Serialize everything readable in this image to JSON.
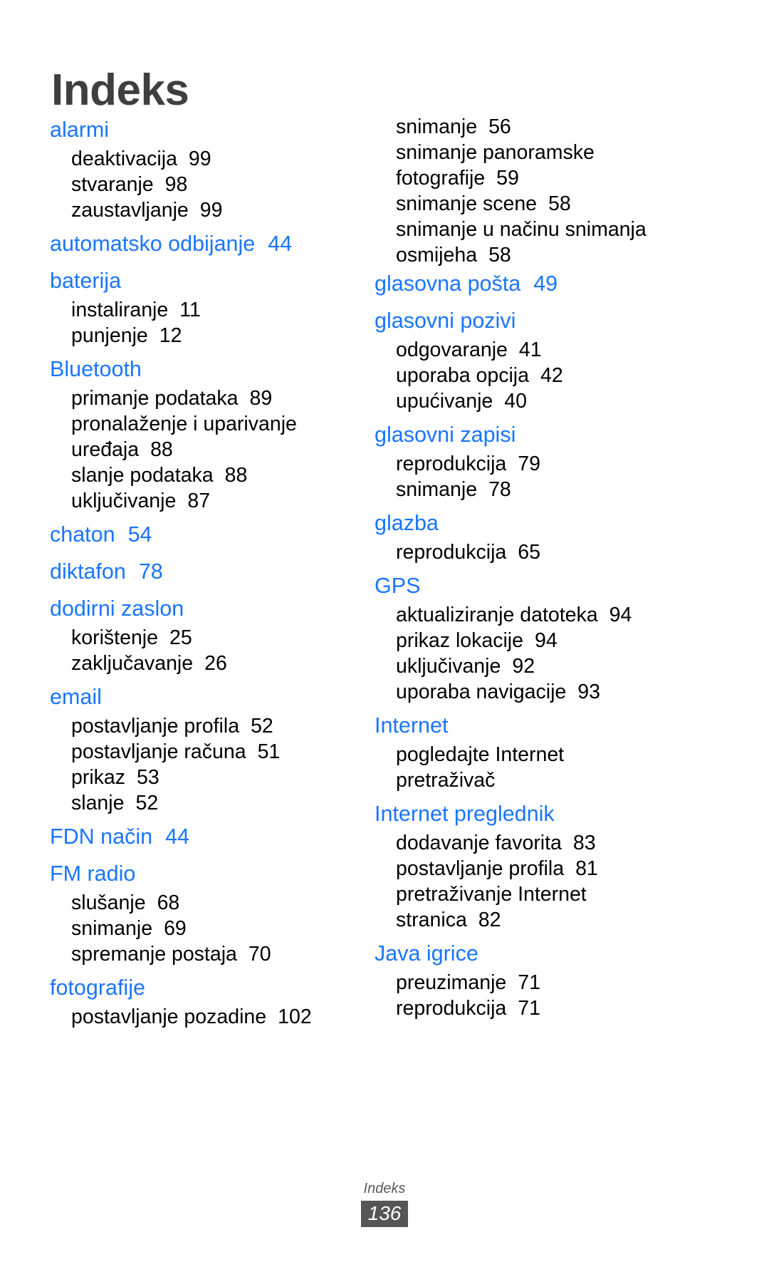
{
  "page_title": "Indeks",
  "footer": {
    "label": "Indeks",
    "page_number": "136"
  },
  "colors": {
    "heading": "#1a75ff",
    "title": "#3f3f3f",
    "body": "#000000",
    "badge_bg": "#565656",
    "badge_text": "#ffffff"
  },
  "columns": [
    {
      "name": "left",
      "entries": [
        {
          "type": "heading",
          "term": "alarmi",
          "page": ""
        },
        {
          "type": "sub",
          "term": "deaktivacija",
          "page": "99"
        },
        {
          "type": "sub",
          "term": "stvaranje",
          "page": "98"
        },
        {
          "type": "sub",
          "term": "zaustavljanje",
          "page": "99"
        },
        {
          "type": "heading",
          "term": "automatsko odbijanje",
          "page": "44"
        },
        {
          "type": "heading",
          "term": "baterija",
          "page": ""
        },
        {
          "type": "sub",
          "term": "instaliranje",
          "page": "11"
        },
        {
          "type": "sub",
          "term": "punjenje",
          "page": "12"
        },
        {
          "type": "heading",
          "term": "Bluetooth",
          "page": ""
        },
        {
          "type": "sub",
          "term": "primanje podataka",
          "page": "89"
        },
        {
          "type": "sub",
          "term": "pronalaženje i uparivanje",
          "page": ""
        },
        {
          "type": "sub",
          "term": "uređaja",
          "page": "88"
        },
        {
          "type": "sub",
          "term": "slanje podataka",
          "page": "88"
        },
        {
          "type": "sub",
          "term": "uključivanje",
          "page": "87"
        },
        {
          "type": "heading",
          "term": "chaton",
          "page": "54"
        },
        {
          "type": "heading",
          "term": "diktafon",
          "page": "78"
        },
        {
          "type": "heading",
          "term": "dodirni zaslon",
          "page": ""
        },
        {
          "type": "sub",
          "term": "korištenje",
          "page": "25"
        },
        {
          "type": "sub",
          "term": "zaključavanje",
          "page": "26"
        },
        {
          "type": "heading",
          "term": "email",
          "page": ""
        },
        {
          "type": "sub",
          "term": "postavljanje profila",
          "page": "52"
        },
        {
          "type": "sub",
          "term": "postavljanje računa",
          "page": "51"
        },
        {
          "type": "sub",
          "term": "prikaz",
          "page": "53"
        },
        {
          "type": "sub",
          "term": "slanje",
          "page": "52"
        },
        {
          "type": "heading",
          "term": "FDN način",
          "page": "44"
        },
        {
          "type": "heading",
          "term": "FM radio",
          "page": ""
        },
        {
          "type": "sub",
          "term": "slušanje",
          "page": "68"
        },
        {
          "type": "sub",
          "term": "snimanje",
          "page": "69"
        },
        {
          "type": "sub",
          "term": "spremanje postaja",
          "page": "70"
        },
        {
          "type": "heading",
          "term": "fotografije",
          "page": ""
        },
        {
          "type": "sub",
          "term": "postavljanje pozadine",
          "page": "102"
        }
      ]
    },
    {
      "name": "right",
      "entries": [
        {
          "type": "sub",
          "term": "snimanje",
          "page": "56"
        },
        {
          "type": "sub",
          "term": "snimanje panoramske",
          "page": ""
        },
        {
          "type": "sub",
          "term": "fotografije",
          "page": "59"
        },
        {
          "type": "sub",
          "term": "snimanje scene",
          "page": "58"
        },
        {
          "type": "sub",
          "term": "snimanje u načinu snimanja",
          "page": ""
        },
        {
          "type": "sub",
          "term": "osmijeha",
          "page": "58"
        },
        {
          "type": "heading",
          "term": "glasovna pošta",
          "page": "49"
        },
        {
          "type": "heading",
          "term": "glasovni pozivi",
          "page": ""
        },
        {
          "type": "sub",
          "term": "odgovaranje",
          "page": "41"
        },
        {
          "type": "sub",
          "term": "uporaba opcija",
          "page": "42"
        },
        {
          "type": "sub",
          "term": "upućivanje",
          "page": "40"
        },
        {
          "type": "heading",
          "term": "glasovni zapisi",
          "page": ""
        },
        {
          "type": "sub",
          "term": "reprodukcija",
          "page": "79"
        },
        {
          "type": "sub",
          "term": "snimanje",
          "page": "78"
        },
        {
          "type": "heading",
          "term": "glazba",
          "page": ""
        },
        {
          "type": "sub",
          "term": "reprodukcija",
          "page": "65"
        },
        {
          "type": "heading",
          "term": "GPS",
          "page": ""
        },
        {
          "type": "sub",
          "term": "aktualiziranje datoteka",
          "page": "94"
        },
        {
          "type": "sub",
          "term": "prikaz lokacije",
          "page": "94"
        },
        {
          "type": "sub",
          "term": "uključivanje",
          "page": "92"
        },
        {
          "type": "sub",
          "term": "uporaba navigacije",
          "page": "93"
        },
        {
          "type": "heading",
          "term": "Internet",
          "page": ""
        },
        {
          "type": "sub",
          "term": "pogledajte Internet",
          "page": ""
        },
        {
          "type": "sub",
          "term": "pretraživač",
          "page": ""
        },
        {
          "type": "heading",
          "term": "Internet preglednik",
          "page": ""
        },
        {
          "type": "sub",
          "term": "dodavanje favorita",
          "page": "83"
        },
        {
          "type": "sub",
          "term": "postavljanje profila",
          "page": "81"
        },
        {
          "type": "sub",
          "term": "pretraživanje Internet",
          "page": ""
        },
        {
          "type": "sub",
          "term": "stranica",
          "page": "82"
        },
        {
          "type": "heading",
          "term": "Java igrice",
          "page": ""
        },
        {
          "type": "sub",
          "term": "preuzimanje",
          "page": "71"
        },
        {
          "type": "sub",
          "term": "reprodukcija",
          "page": "71"
        }
      ]
    }
  ]
}
